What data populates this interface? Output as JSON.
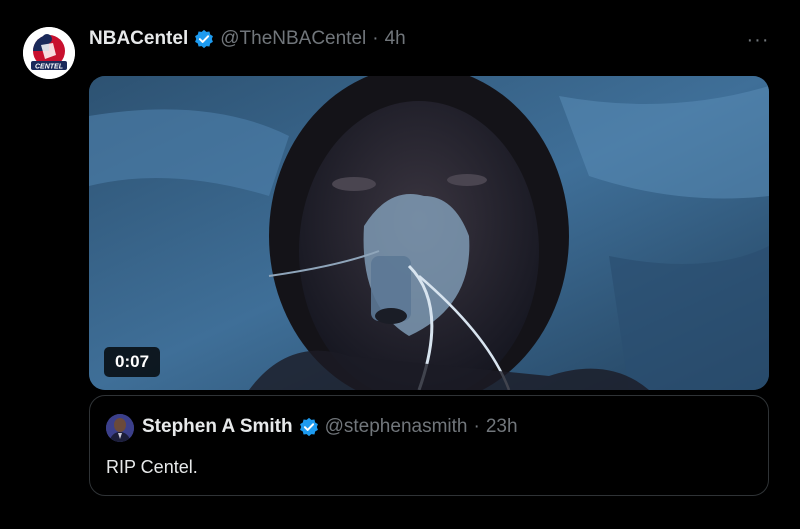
{
  "tweet": {
    "author_name": "NBACentel",
    "author_handle": "@TheNBACentel",
    "time_sep": "·",
    "time": "4h",
    "avatar_text": "CENTEL",
    "more_label": "···",
    "video": {
      "duration": "0:07"
    }
  },
  "quoted_tweet": {
    "author_name": "Stephen A Smith",
    "author_handle": "@stephenasmith",
    "time_sep": "·",
    "time": "23h",
    "text": "RIP Centel."
  },
  "colors": {
    "background": "#000000",
    "primary_text": "#e7e9ea",
    "secondary_text": "#71767b",
    "verified_blue": "#1d9bf0",
    "border": "#2f3336"
  },
  "icons": {
    "verified": "verified-badge-icon",
    "more": "more-horizontal-icon"
  }
}
